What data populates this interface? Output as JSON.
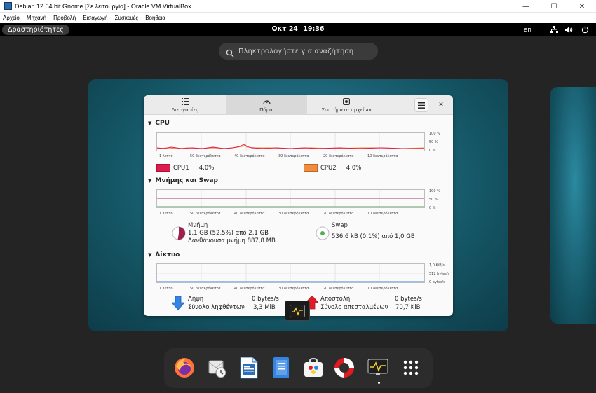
{
  "host": {
    "title": "Debian 12 64 bit Gnome [Σε λειτουργία] - Oracle VM VirtualBox",
    "window_controls": {
      "minimize": "—",
      "maximize": "☐",
      "close": "✕"
    },
    "menu": [
      "Αρχείο",
      "Μηχανή",
      "Προβολή",
      "Εισαγωγή",
      "Συσκευές",
      "Βοήθεια"
    ]
  },
  "topbar": {
    "activities": "Δραστηριότητες",
    "date": "Οκτ 24",
    "time": "19:36",
    "language": "en"
  },
  "search": {
    "placeholder": "Πληκτρολογήστε για αναζήτηση"
  },
  "sysmon": {
    "tabs": [
      {
        "label": "Διεργασίες",
        "icon": "list-icon",
        "active": false
      },
      {
        "label": "Πόροι",
        "icon": "gauge-icon",
        "active": true
      },
      {
        "label": "Συστήματα αρχείων",
        "icon": "disk-icon",
        "active": false
      }
    ],
    "cpu": {
      "title": "CPU",
      "y_ticks": [
        "100 %",
        "50 %",
        "0 %"
      ],
      "x_ticks": [
        "1 λεπτό",
        "50 δευτερόλεπτα",
        "40 δευτερόλεπτα",
        "30 δευτερόλεπτα",
        "20 δευτερόλεπτα",
        "10 δευτερόλεπτα"
      ],
      "cores": [
        {
          "label": "CPU1",
          "value": "4,0%",
          "color": "#e01b4c"
        },
        {
          "label": "CPU2",
          "value": "4,0%",
          "color": "#f38b3c"
        }
      ]
    },
    "memory": {
      "title": "Μνήμης και Swap",
      "y_ticks": [
        "100 %",
        "50 %",
        "0 %"
      ],
      "x_ticks": [
        "1 λεπτό",
        "50 δευτερόλεπτα",
        "40 δευτερόλεπτα",
        "30 δευτερόλεπτα",
        "20 δευτερόλεπτα",
        "10 δευτερόλεπτα"
      ],
      "mem_label": "Μνήμη",
      "mem_value": "1,1 GB (52,5%) από 2,1 GB",
      "mem_cache": "Λανθάνουσα μνήμη 887,8 MB",
      "mem_color": "#a01e4e",
      "mem_fraction": 0.525,
      "swap_label": "Swap",
      "swap_value": "536,6 kB (0,1%) από 1,0 GB",
      "swap_color": "#4caf50"
    },
    "network": {
      "title": "Δίκτυο",
      "y_ticks": [
        "1,0 KiB/s",
        "512 bytes/s",
        "0 bytes/s"
      ],
      "x_ticks": [
        "1 λεπτό",
        "50 δευτερόλεπτα",
        "40 δευτερόλεπτα",
        "30 δευτερόλεπτα",
        "20 δευτερόλεπτα",
        "10 δευτερόλεπτα"
      ],
      "recv_label": "Λήψη",
      "recv_rate": "0 bytes/s",
      "recv_total_label": "Σύνολο ληφθέντων",
      "recv_total": "3,3 MiB",
      "send_label": "Αποστολή",
      "send_rate": "0 bytes/s",
      "send_total_label": "Σύνολο απεσταλμένων",
      "send_total": "70,7 KiB"
    }
  },
  "dock": {
    "apps": [
      "firefox-icon",
      "evolution-icon",
      "writer-icon",
      "text-editor-icon",
      "software-icon",
      "help-icon",
      "system-monitor-icon",
      "app-grid-icon"
    ]
  }
}
